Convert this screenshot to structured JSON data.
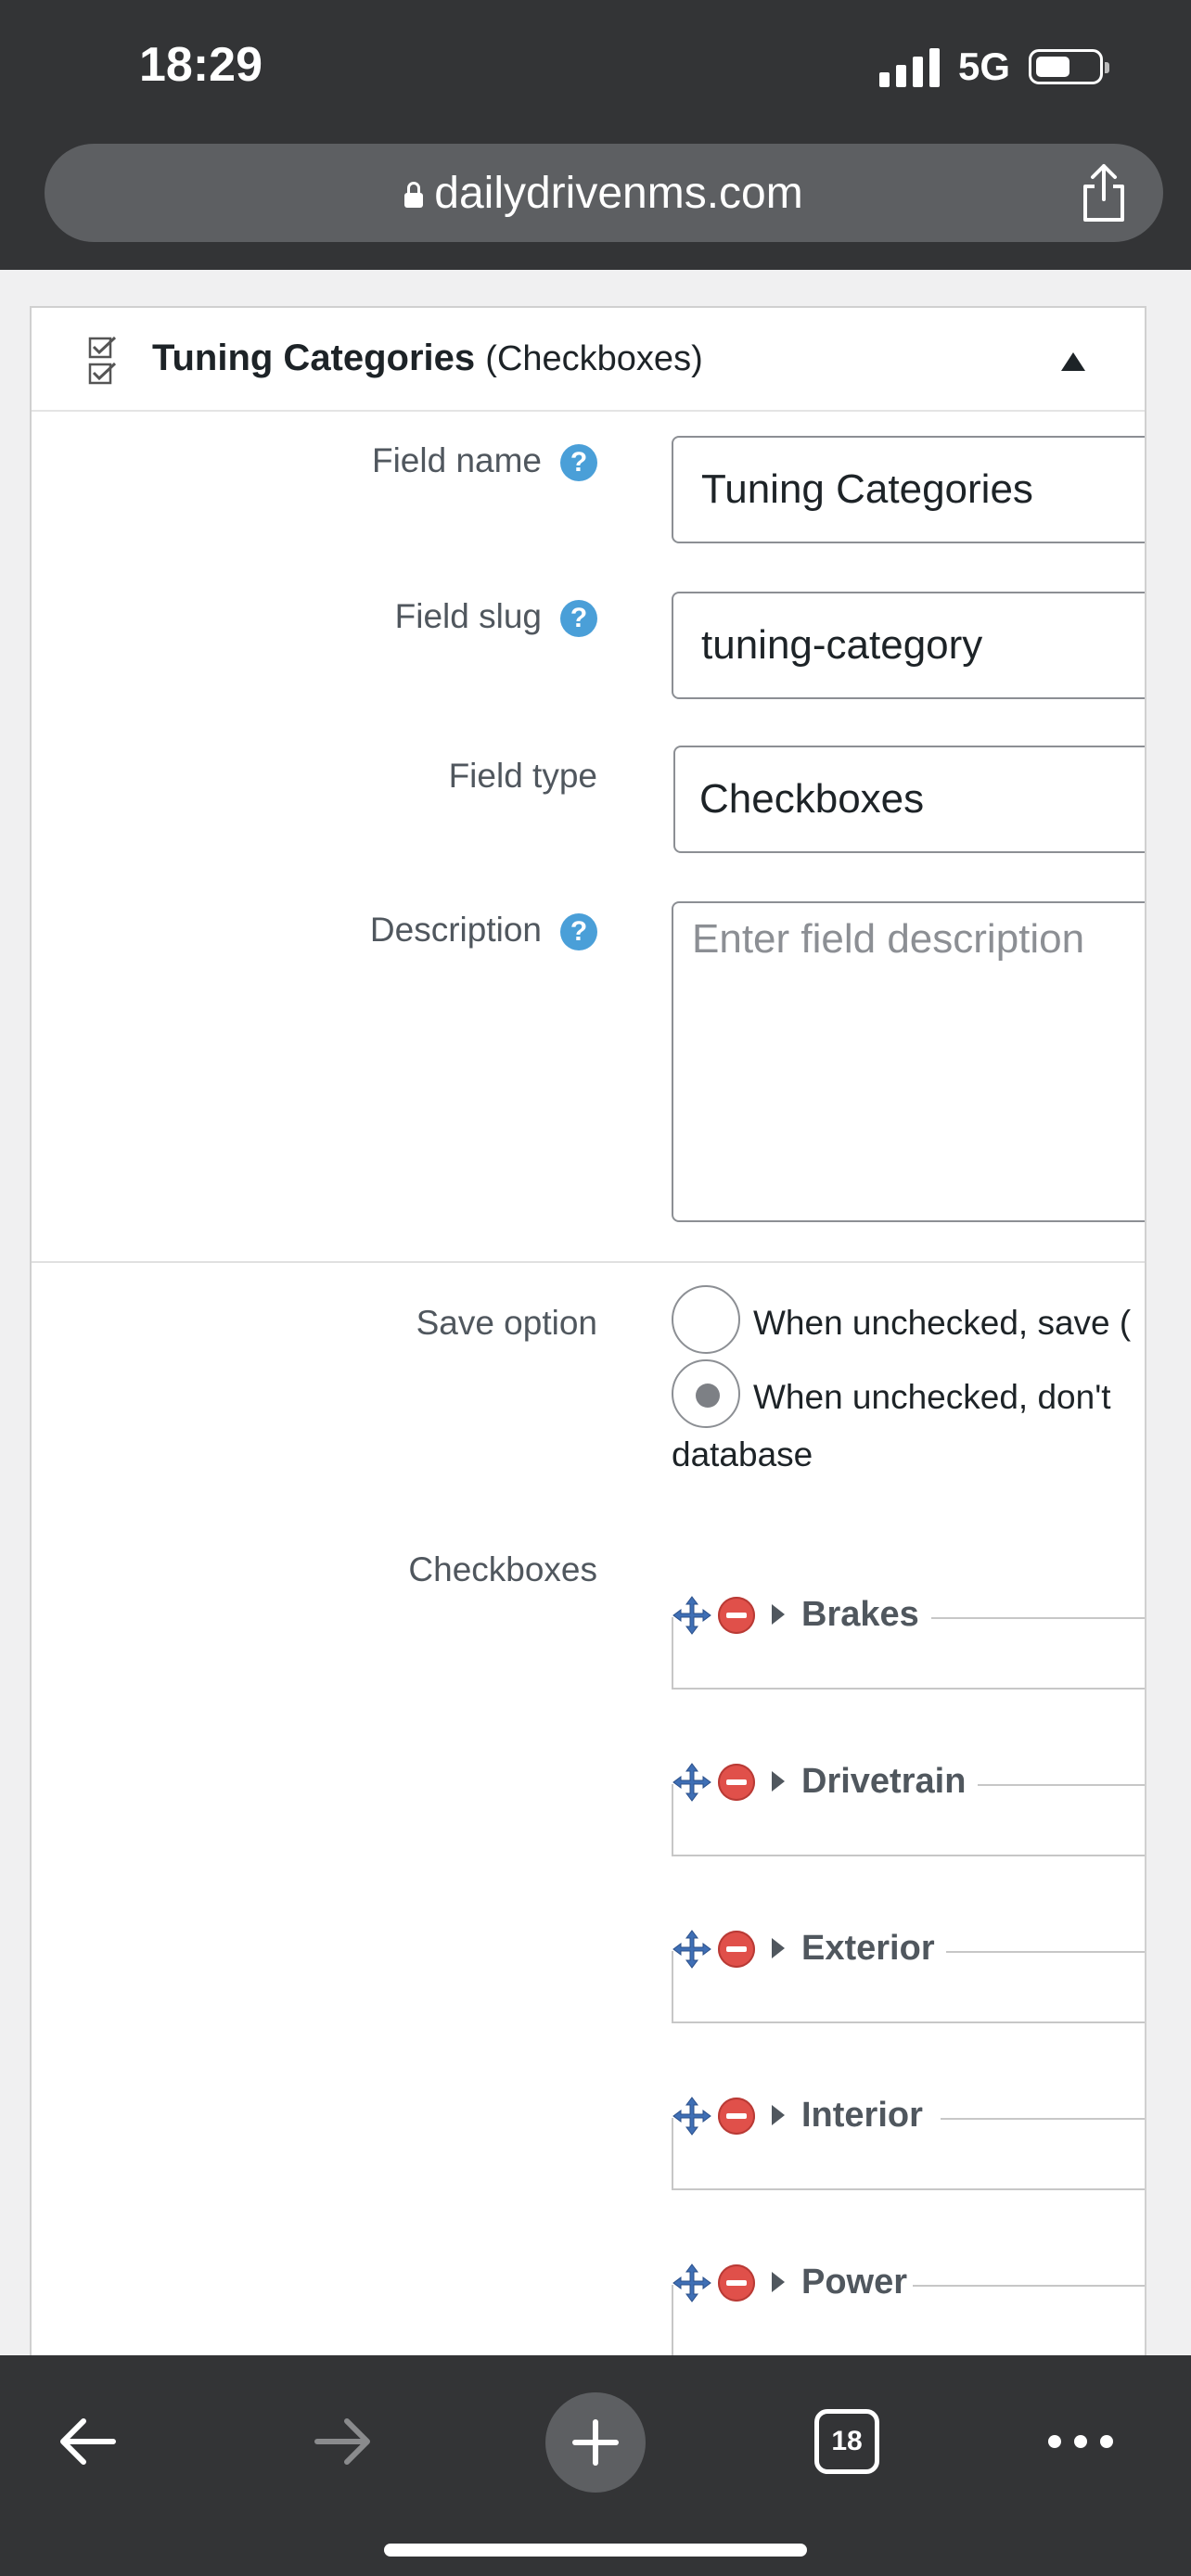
{
  "status": {
    "time": "18:29",
    "network": "5G"
  },
  "browser": {
    "url": "dailydrivenms.com"
  },
  "panel": {
    "title": "Tuning Categories",
    "type": "(Checkboxes)"
  },
  "form": {
    "field_name_label": "Field name",
    "field_name_value": "Tuning Categories",
    "field_slug_label": "Field slug",
    "field_slug_value": "tuning-category",
    "field_type_label": "Field type",
    "field_type_value": "Checkboxes",
    "description_label": "Description",
    "description_placeholder": "Enter field description",
    "help_glyph": "?",
    "save_option_label": "Save option",
    "save_option_1": "When unchecked, save (",
    "save_option_2": "When unchecked, don't",
    "save_option_2_cont": "database",
    "checkboxes_label": "Checkboxes",
    "checkboxes": [
      "Brakes",
      "Drivetrain",
      "Exterior",
      "Interior",
      "Power"
    ]
  },
  "toolbar": {
    "tab_count": "18"
  }
}
